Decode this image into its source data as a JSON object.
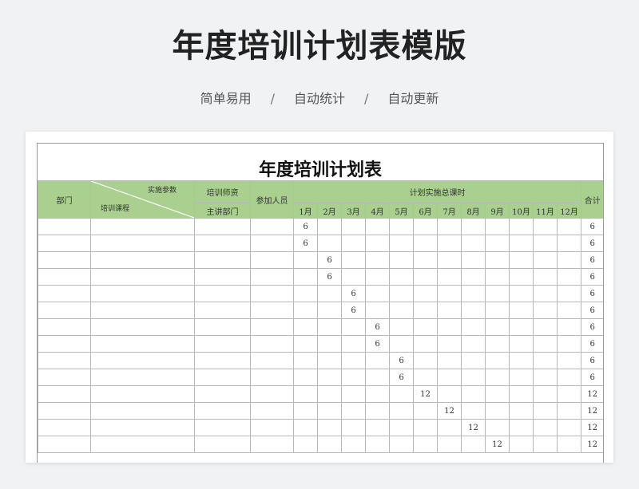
{
  "hero": {
    "title": "年度培训计划表模版",
    "tags": [
      "简单易用",
      "自动统计",
      "自动更新"
    ],
    "separator": "/"
  },
  "sheet": {
    "title": "年度培训计划表",
    "headers": {
      "department": "部门",
      "diag_top": "实施参数",
      "diag_bottom": "培训课程",
      "trainer": "培训师资",
      "lead_dept": "主讲部门",
      "participants": "参加人员",
      "total_hours": "计划实施总课时",
      "sum": "合计",
      "months": [
        "1月",
        "2月",
        "3月",
        "4月",
        "5月",
        "6月",
        "7月",
        "8月",
        "9月",
        "10月",
        "11月",
        "12月"
      ]
    },
    "rows": [
      {
        "month": 1,
        "hours": "6",
        "total": "6"
      },
      {
        "month": 1,
        "hours": "6",
        "total": "6"
      },
      {
        "month": 2,
        "hours": "6",
        "total": "6"
      },
      {
        "month": 2,
        "hours": "6",
        "total": "6"
      },
      {
        "month": 3,
        "hours": "6",
        "total": "6"
      },
      {
        "month": 3,
        "hours": "6",
        "total": "6"
      },
      {
        "month": 4,
        "hours": "6",
        "total": "6"
      },
      {
        "month": 4,
        "hours": "6",
        "total": "6"
      },
      {
        "month": 5,
        "hours": "6",
        "total": "6"
      },
      {
        "month": 5,
        "hours": "6",
        "total": "6"
      },
      {
        "month": 6,
        "hours": "12",
        "total": "12"
      },
      {
        "month": 7,
        "hours": "12",
        "total": "12"
      },
      {
        "month": 8,
        "hours": "12",
        "total": "12"
      },
      {
        "month": 9,
        "hours": "12",
        "total": "12"
      }
    ]
  },
  "colors": {
    "header_green": "#a9d08e",
    "background": "#f1f2f4"
  }
}
